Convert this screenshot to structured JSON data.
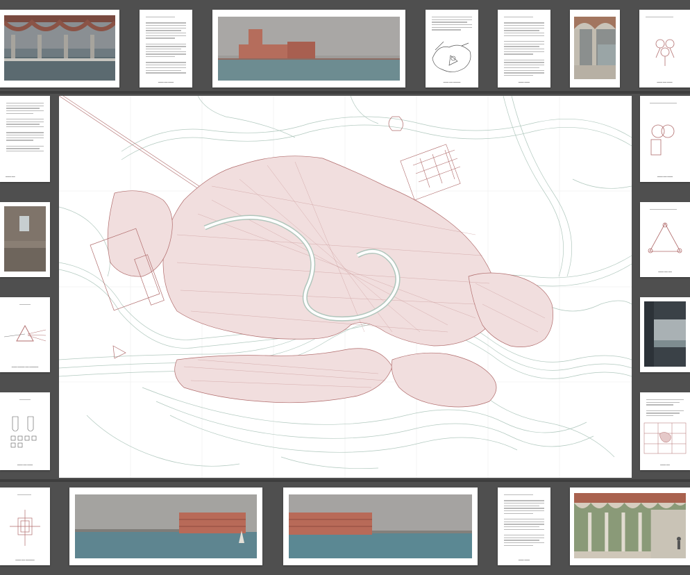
{
  "board": {
    "background": "#4f4f4f",
    "map_ink": "#b06b6b",
    "water_ink": "#a9c3b8"
  },
  "icons": {
    "map": "city-map-figure",
    "prism": "prism-diagram-icon",
    "plan": "floor-plan-icon",
    "sketch": "sketch-map-icon"
  }
}
